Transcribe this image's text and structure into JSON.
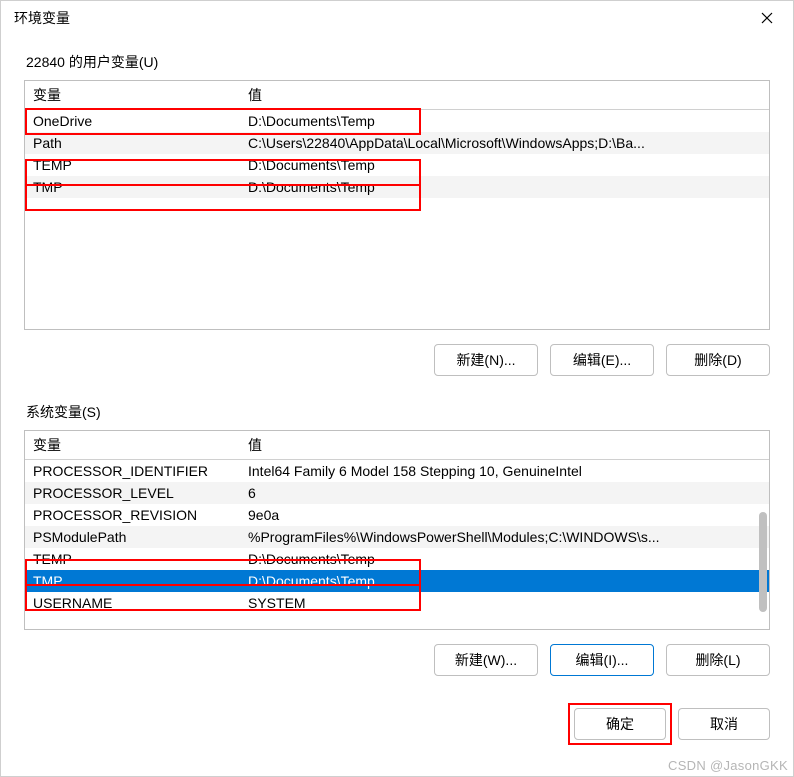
{
  "dialog": {
    "title": "环境变量"
  },
  "user": {
    "group_label": "22840 的用户变量(U)",
    "headers": {
      "var": "变量",
      "val": "值"
    },
    "rows": [
      {
        "var": "OneDrive",
        "val": "D:\\Documents\\Temp"
      },
      {
        "var": "Path",
        "val": "C:\\Users\\22840\\AppData\\Local\\Microsoft\\WindowsApps;D:\\Ba..."
      },
      {
        "var": "TEMP",
        "val": "D:\\Documents\\Temp"
      },
      {
        "var": "TMP",
        "val": "D:\\Documents\\Temp"
      }
    ],
    "buttons": {
      "new": "新建(N)...",
      "edit": "编辑(E)...",
      "delete": "删除(D)"
    }
  },
  "system": {
    "group_label": "系统变量(S)",
    "headers": {
      "var": "变量",
      "val": "值"
    },
    "rows": [
      {
        "var": "PROCESSOR_IDENTIFIER",
        "val": "Intel64 Family 6 Model 158 Stepping 10, GenuineIntel"
      },
      {
        "var": "PROCESSOR_LEVEL",
        "val": "6"
      },
      {
        "var": "PROCESSOR_REVISION",
        "val": "9e0a"
      },
      {
        "var": "PSModulePath",
        "val": "%ProgramFiles%\\WindowsPowerShell\\Modules;C:\\WINDOWS\\s..."
      },
      {
        "var": "TEMP",
        "val": "D:\\Documents\\Temp"
      },
      {
        "var": "TMP",
        "val": "D:\\Documents\\Temp"
      },
      {
        "var": "USERNAME",
        "val": "SYSTEM"
      }
    ],
    "buttons": {
      "new": "新建(W)...",
      "edit": "编辑(I)...",
      "delete": "删除(L)"
    }
  },
  "bottom": {
    "ok": "确定",
    "cancel": "取消"
  },
  "watermark": "CSDN @JasonGKK",
  "colors": {
    "highlight": "#ff0000",
    "primary": "#0078d4"
  }
}
